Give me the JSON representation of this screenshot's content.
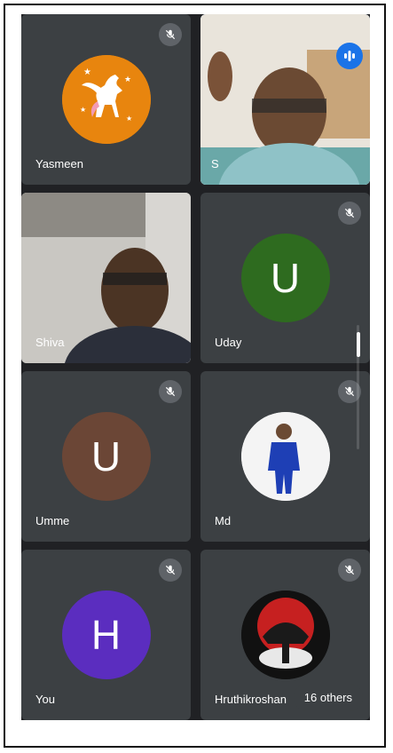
{
  "participants": [
    {
      "name": "Yasmeen",
      "muted": true,
      "avatar": "pegasus-avatar",
      "avatar_color": "#e8850e"
    },
    {
      "name": "S",
      "muted": false,
      "speaking": true,
      "video": true
    },
    {
      "name": "Shiva",
      "muted": false,
      "video": true
    },
    {
      "name": "Uday",
      "muted": true,
      "initial": "U",
      "avatar_color": "#2e6b1f"
    },
    {
      "name": "Umme",
      "muted": true,
      "initial": "U",
      "avatar_color": "#6b4636"
    },
    {
      "name": "Md",
      "muted": true,
      "avatar": "person-photo-avatar"
    },
    {
      "name": "You",
      "muted": true,
      "initial": "H",
      "avatar_color": "#5b2dbf"
    },
    {
      "name": "Hruthikroshan",
      "muted": true,
      "avatar": "red-emblem-avatar"
    }
  ],
  "others_label": "16 others",
  "colors": {
    "background": "#202124",
    "tile": "#3c4043",
    "speaking_outline": "#8ab4f8"
  }
}
